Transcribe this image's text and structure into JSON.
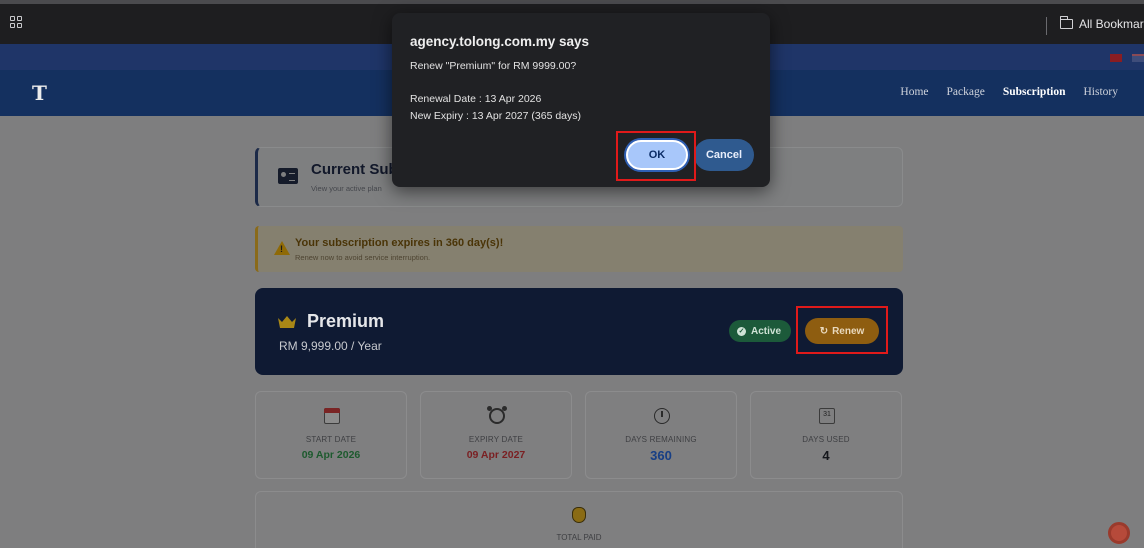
{
  "browser": {
    "all_bookmarks_label": "All Bookmarks"
  },
  "nav": {
    "logo_text": "T",
    "links": [
      "Home",
      "Package",
      "Subscription",
      "History"
    ],
    "active_link": "Subscription"
  },
  "subscription_card": {
    "title": "Current Sub",
    "description": "View your active plan"
  },
  "warning": {
    "title": "Your subscription expires in 360 day(s)!",
    "subtitle": "Renew now to avoid service interruption."
  },
  "plan": {
    "name": "Premium",
    "price": "RM 9,999.00 / Year",
    "status_label": "Active",
    "renew_label": "Renew",
    "status_color": "#1c5a3a",
    "renew_color": "#8e5d10"
  },
  "stats": [
    {
      "label": "START DATE",
      "value": "09 Apr 2026",
      "color": "#1d5a2e",
      "icon": "calendar-icon"
    },
    {
      "label": "EXPIRY DATE",
      "value": "09 Apr 2027",
      "color": "#7a1f22",
      "icon": "alarm-clock-icon"
    },
    {
      "label": "DAYS REMAINING",
      "value": "360",
      "color": "#173f85",
      "icon": "clock-icon"
    },
    {
      "label": "DAYS USED",
      "value": "4",
      "color": "#15171c",
      "icon": "calendar-31-icon"
    }
  ],
  "total": {
    "label": "TOTAL PAID"
  },
  "dialog": {
    "title": "agency.tolong.com.my says",
    "message": "Renew \"Premium\" for RM 9999.00?",
    "renewal_date": "Renewal Date : 13 Apr 2026",
    "new_expiry": "New Expiry : 13 Apr 2027 (365 days)",
    "ok_label": "OK",
    "cancel_label": "Cancel"
  }
}
